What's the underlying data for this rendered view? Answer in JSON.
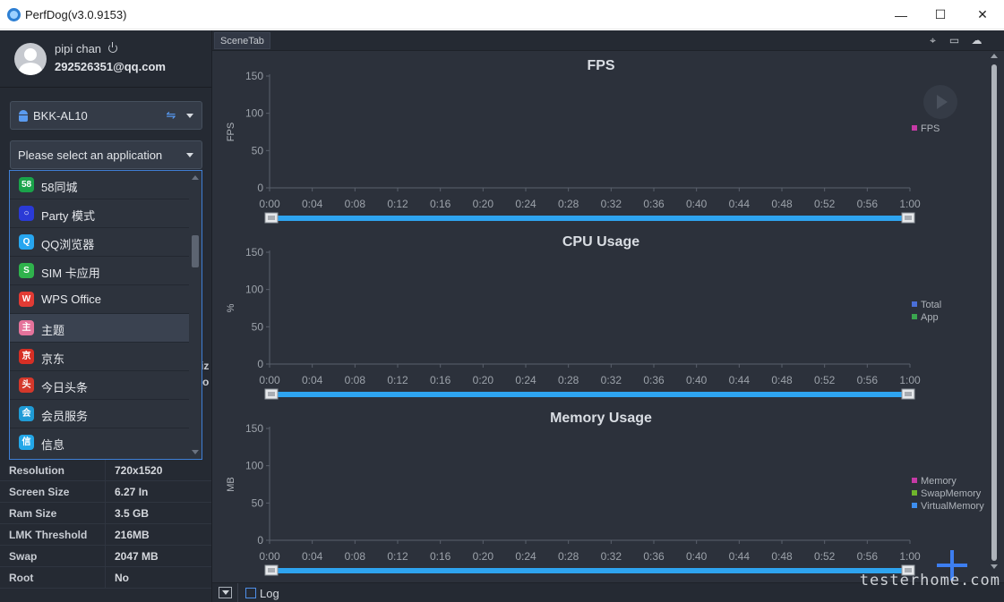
{
  "window": {
    "title": "PerfDog(v3.0.9153)",
    "minimize": "—",
    "maximize": "☐",
    "close": "✕"
  },
  "user": {
    "name": "pipi chan",
    "email": "292526351@qq.com"
  },
  "device_select": {
    "value": "BKK-AL10"
  },
  "app_select": {
    "placeholder": "Please select an application"
  },
  "apps": [
    {
      "label": "58同城",
      "icon": "58",
      "color": "#1aa34a"
    },
    {
      "label": "Party 模式",
      "icon": "○",
      "color": "#2a3ad6"
    },
    {
      "label": "QQ浏览器",
      "icon": "Q",
      "color": "#27a6f0"
    },
    {
      "label": "SIM 卡应用",
      "icon": "S",
      "color": "#2fb24c"
    },
    {
      "label": "WPS Office",
      "icon": "W",
      "color": "#e23b34"
    },
    {
      "label": "主题",
      "icon": "主",
      "color": "#e5739b"
    },
    {
      "label": "京东",
      "icon": "京",
      "color": "#d72f25"
    },
    {
      "label": "今日头条",
      "icon": "头",
      "color": "#d4382b"
    },
    {
      "label": "会员服务",
      "icon": "会",
      "color": "#1f9bd6"
    },
    {
      "label": "信息",
      "icon": "信",
      "color": "#23a7e8"
    }
  ],
  "peek": {
    "a": "iz",
    "b": "o"
  },
  "device_info": [
    {
      "key": "Resolution",
      "value": "720x1520"
    },
    {
      "key": "Screen Size",
      "value": "6.27 In"
    },
    {
      "key": "Ram Size",
      "value": "3.5 GB"
    },
    {
      "key": "LMK Threshold",
      "value": "216MB"
    },
    {
      "key": "Swap",
      "value": "2047 MB"
    },
    {
      "key": "Root",
      "value": "No"
    }
  ],
  "scene_tab": "SceneTab",
  "log_label": "Log",
  "watermark": "testerhome.com",
  "charts": [
    {
      "title": "FPS",
      "ylabel": "FPS",
      "legend": [
        {
          "name": "FPS",
          "color": "#c63aa6"
        }
      ]
    },
    {
      "title": "CPU Usage",
      "ylabel": "%",
      "legend": [
        {
          "name": "Total",
          "color": "#4a6fd8"
        },
        {
          "name": "App",
          "color": "#3aa64f"
        }
      ]
    },
    {
      "title": "Memory Usage",
      "ylabel": "MB",
      "legend": [
        {
          "name": "Memory",
          "color": "#c63aa6"
        },
        {
          "name": "SwapMemory",
          "color": "#6fb52c"
        },
        {
          "name": "VirtualMemory",
          "color": "#3d8ef0"
        }
      ]
    }
  ],
  "chart_data": [
    {
      "type": "line",
      "title": "FPS",
      "ylabel": "FPS",
      "ylim": [
        0,
        150
      ],
      "yticks": [
        "150",
        "100",
        "50",
        "0"
      ],
      "xticks": [
        "0:00",
        "0:04",
        "0:08",
        "0:12",
        "0:16",
        "0:20",
        "0:24",
        "0:28",
        "0:32",
        "0:36",
        "0:40",
        "0:44",
        "0:48",
        "0:52",
        "0:56",
        "1:00"
      ],
      "series": [
        {
          "name": "FPS",
          "values": []
        }
      ]
    },
    {
      "type": "line",
      "title": "CPU Usage",
      "ylabel": "%",
      "ylim": [
        0,
        150
      ],
      "yticks": [
        "150",
        "100",
        "50",
        "0"
      ],
      "xticks": [
        "0:00",
        "0:04",
        "0:08",
        "0:12",
        "0:16",
        "0:20",
        "0:24",
        "0:28",
        "0:32",
        "0:36",
        "0:40",
        "0:44",
        "0:48",
        "0:52",
        "0:56",
        "1:00"
      ],
      "series": [
        {
          "name": "Total",
          "values": []
        },
        {
          "name": "App",
          "values": []
        }
      ]
    },
    {
      "type": "line",
      "title": "Memory Usage",
      "ylabel": "MB",
      "ylim": [
        0,
        150
      ],
      "yticks": [
        "150",
        "100",
        "50",
        "0"
      ],
      "xticks": [
        "0:00",
        "0:04",
        "0:08",
        "0:12",
        "0:16",
        "0:20",
        "0:24",
        "0:28",
        "0:32",
        "0:36",
        "0:40",
        "0:44",
        "0:48",
        "0:52",
        "0:56",
        "1:00"
      ],
      "series": [
        {
          "name": "Memory",
          "values": []
        },
        {
          "name": "SwapMemory",
          "values": []
        },
        {
          "name": "VirtualMemory",
          "values": []
        }
      ]
    }
  ]
}
